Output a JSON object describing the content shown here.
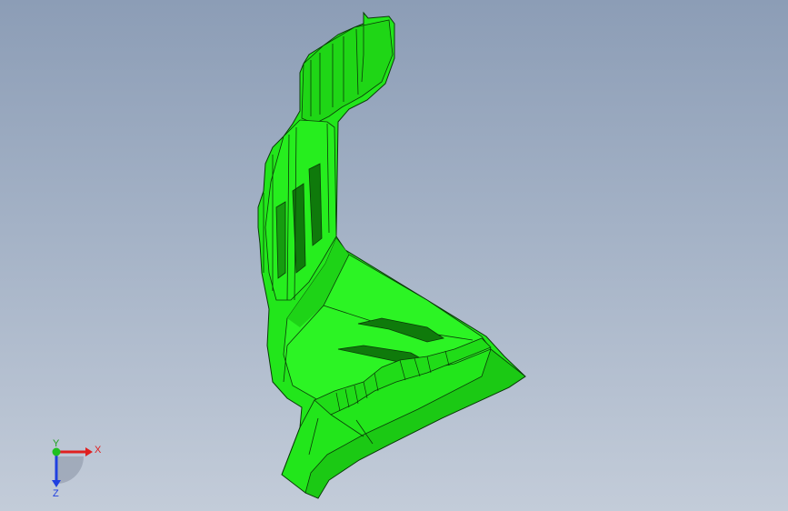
{
  "viewport": {
    "background_top": "#8c9db6",
    "background_bottom": "#c3ccd9"
  },
  "model": {
    "color": "#22e61b",
    "edge_color": "#0a3a08"
  },
  "triad": {
    "x_label": "X",
    "y_label": "Y",
    "z_label": "Z",
    "x_color": "#e02020",
    "y_color": "#20c020",
    "z_color": "#2040e0"
  }
}
